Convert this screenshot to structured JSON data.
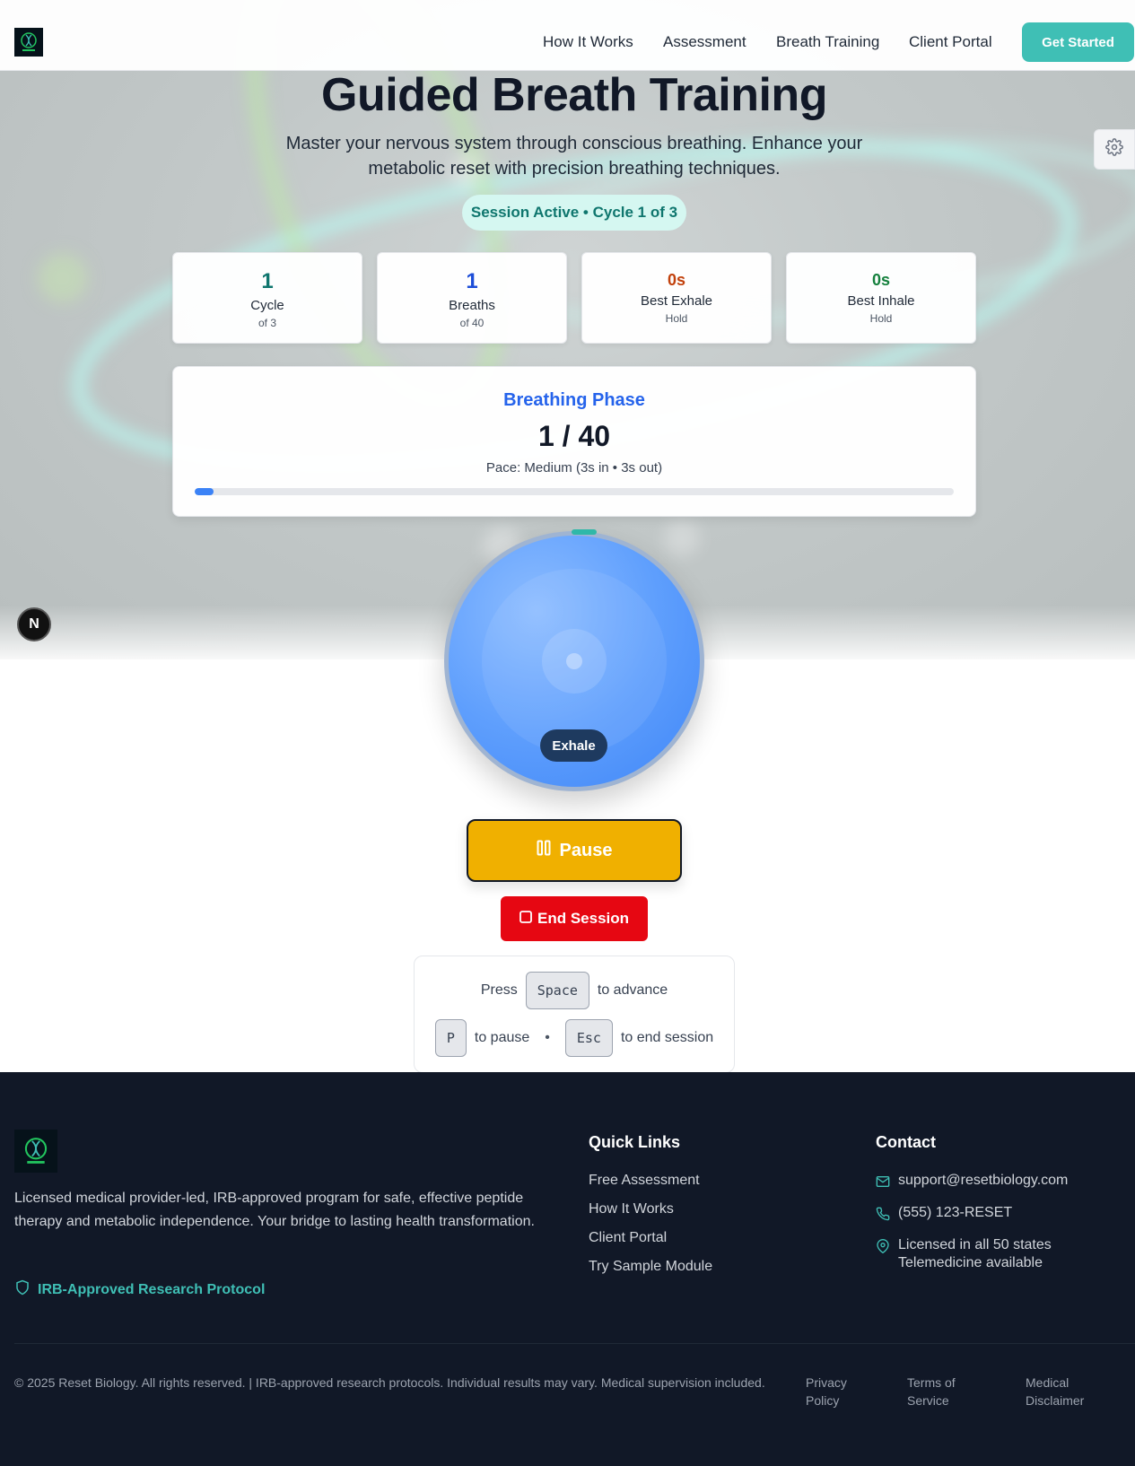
{
  "nav": {
    "links": [
      "How It Works",
      "Assessment",
      "Breath Training",
      "Client Portal"
    ],
    "cta": "Get Started"
  },
  "hero": {
    "title": "Guided Breath Training",
    "subtitle": "Master your nervous system through conscious breathing. Enhance your metabolic reset with precision breathing techniques.",
    "status": "Session Active • Cycle 1 of 3"
  },
  "stats": [
    {
      "value": "1",
      "label": "Cycle",
      "sub": "of 3",
      "color": "#0f766e"
    },
    {
      "value": "1",
      "label": "Breaths",
      "sub": "of 40",
      "color": "#1d4ed8"
    },
    {
      "value": "0s",
      "label": "Best Exhale",
      "sub": "Hold",
      "color": "#c2410c"
    },
    {
      "value": "0s",
      "label": "Best Inhale",
      "sub": "Hold",
      "color": "#15803d"
    }
  ],
  "phase": {
    "heading": "Breathing Phase",
    "count": "1 / 40",
    "pace": "Pace: Medium (3s in • 3s out)",
    "progress": 0.025
  },
  "circle": {
    "phase_label": "Exhale"
  },
  "controls": {
    "pause": "Pause",
    "end": "End Session"
  },
  "shortcuts": {
    "press": "Press",
    "space": "Space",
    "to_advance": "to advance",
    "p": "P",
    "to_pause": "to pause",
    "sep": "•",
    "esc": "Esc",
    "to_end": "to end session"
  },
  "footer": {
    "description": "Licensed medical provider-led, IRB-approved program for safe, effective peptide therapy and metabolic independence. Your bridge to lasting health transformation.",
    "irb": "IRB-Approved Research Protocol",
    "quick_links_title": "Quick Links",
    "quick_links": [
      "Free Assessment",
      "How It Works",
      "Client Portal",
      "Try Sample Module"
    ],
    "contact_title": "Contact",
    "email": "support@resetbiology.com",
    "phone": "(555) 123-RESET",
    "license_1": "Licensed in all 50 states",
    "license_2": "Telemedicine available",
    "copyright": "© 2025 Reset Biology. All rights reserved. | IRB-approved research protocols. Individual results may vary. Medical supervision included.",
    "legal": [
      "Privacy Policy",
      "Terms of Service",
      "Medical Disclaimer"
    ]
  },
  "badge": "N",
  "colors": {
    "accent": "#3fbfb5",
    "pause": "#f0b000",
    "end": "#e60712",
    "footer_bg": "#111827"
  }
}
